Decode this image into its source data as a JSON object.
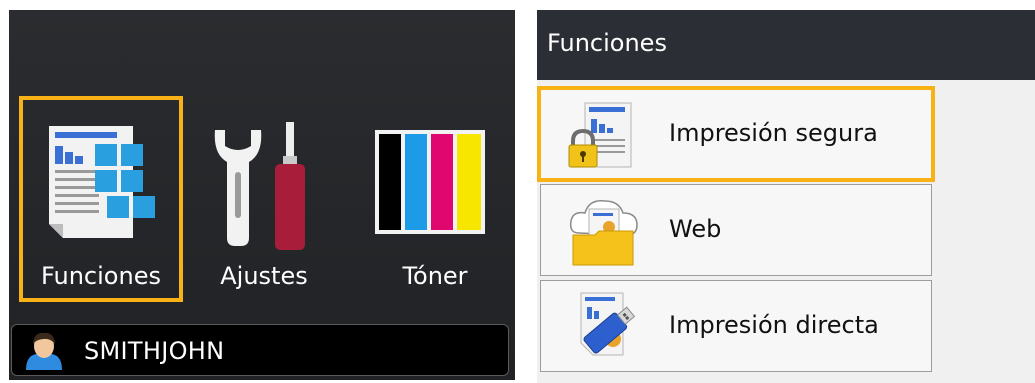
{
  "home": {
    "tiles": [
      {
        "label": "Funciones",
        "icon": "functions-icon"
      },
      {
        "label": "Ajustes",
        "icon": "settings-tools-icon"
      },
      {
        "label": "Tóner",
        "icon": "toner-icon"
      }
    ],
    "user": {
      "name": "SMITHJOHN",
      "icon": "user-avatar-icon"
    },
    "toner_colors": [
      "#000000",
      "#1e9be6",
      "#e0086e",
      "#f7e600"
    ],
    "highlight_color": "#f8b215"
  },
  "menu": {
    "title": "Funciones",
    "items": [
      {
        "label": "Impresión segura",
        "icon": "secure-print-icon"
      },
      {
        "label": "Web",
        "icon": "web-folder-icon"
      },
      {
        "label": "Impresión directa",
        "icon": "usb-direct-print-icon"
      }
    ]
  }
}
